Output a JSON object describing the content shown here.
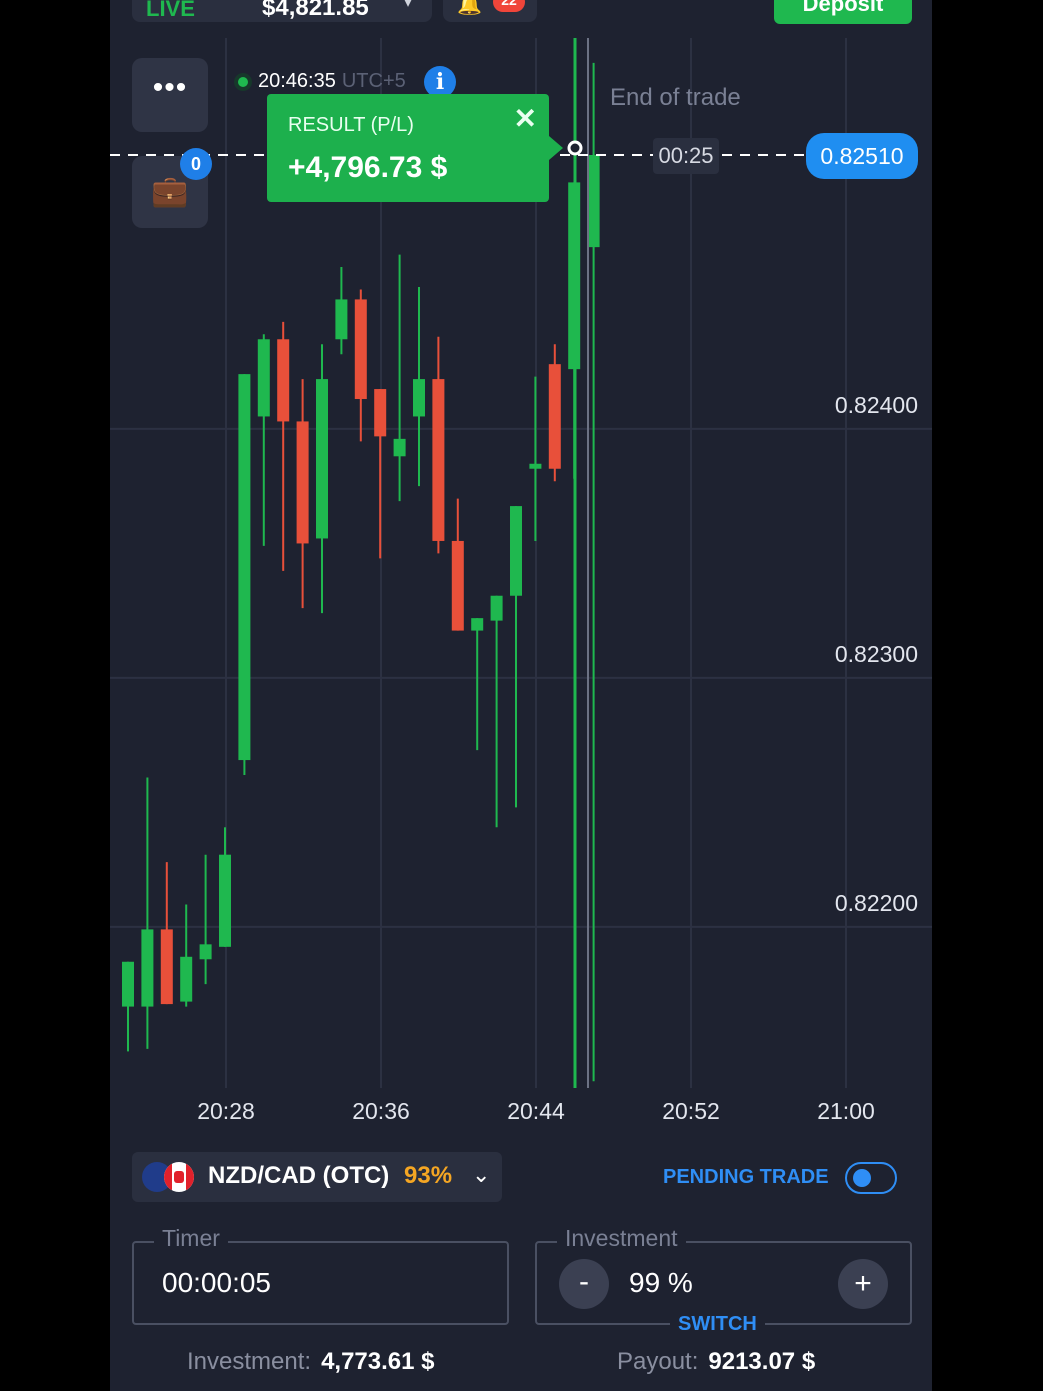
{
  "topbar": {
    "account_label": "LIVE",
    "balance": "$4,821.85",
    "notifications": "22",
    "deposit_label": "Deposit"
  },
  "chart_header": {
    "time": "20:46:35",
    "timezone": "UTC+5",
    "end_of_trade": "End of trade",
    "countdown": "00:25",
    "current_price": "0.82510",
    "open_trades": "0"
  },
  "result_popup": {
    "title": "RESULT (P/L)",
    "amount": "+4,796.73 $"
  },
  "axes": {
    "y_ticks": [
      "0.82400",
      "0.82300",
      "0.82200"
    ],
    "x_ticks": [
      "20:28",
      "20:36",
      "20:44",
      "20:52",
      "21:00"
    ]
  },
  "chart_data": {
    "type": "candlestick",
    "ylim": [
      0.82138,
      0.82556
    ],
    "x_ticks": [
      "20:28",
      "20:36",
      "20:44",
      "20:52",
      "21:00"
    ],
    "current_price": 0.8251,
    "candles": [
      {
        "o": 0.82168,
        "h": 0.8218,
        "l": 0.8215,
        "c": 0.82186,
        "dir": "up"
      },
      {
        "o": 0.82168,
        "h": 0.8226,
        "l": 0.82151,
        "c": 0.82199,
        "dir": "up"
      },
      {
        "o": 0.82199,
        "h": 0.82226,
        "l": 0.82174,
        "c": 0.82169,
        "dir": "down"
      },
      {
        "o": 0.8217,
        "h": 0.82209,
        "l": 0.82168,
        "c": 0.82188,
        "dir": "up"
      },
      {
        "o": 0.82187,
        "h": 0.82229,
        "l": 0.82177,
        "c": 0.82193,
        "dir": "up"
      },
      {
        "o": 0.82192,
        "h": 0.8224,
        "l": 0.82192,
        "c": 0.82229,
        "dir": "up"
      },
      {
        "o": 0.82267,
        "h": 0.82412,
        "l": 0.82261,
        "c": 0.82422,
        "dir": "up"
      },
      {
        "o": 0.82405,
        "h": 0.82438,
        "l": 0.82353,
        "c": 0.82436,
        "dir": "up"
      },
      {
        "o": 0.82436,
        "h": 0.82443,
        "l": 0.82343,
        "c": 0.82403,
        "dir": "down"
      },
      {
        "o": 0.82403,
        "h": 0.8242,
        "l": 0.82328,
        "c": 0.82354,
        "dir": "down"
      },
      {
        "o": 0.82356,
        "h": 0.82434,
        "l": 0.82326,
        "c": 0.8242,
        "dir": "up"
      },
      {
        "o": 0.82436,
        "h": 0.82465,
        "l": 0.8243,
        "c": 0.82452,
        "dir": "up"
      },
      {
        "o": 0.82452,
        "h": 0.82456,
        "l": 0.82395,
        "c": 0.82412,
        "dir": "down"
      },
      {
        "o": 0.82416,
        "h": 0.82388,
        "l": 0.82348,
        "c": 0.82397,
        "dir": "down"
      },
      {
        "o": 0.82396,
        "h": 0.8247,
        "l": 0.82371,
        "c": 0.82389,
        "dir": "up"
      },
      {
        "o": 0.82405,
        "h": 0.82457,
        "l": 0.82377,
        "c": 0.8242,
        "dir": "up"
      },
      {
        "o": 0.8242,
        "h": 0.82437,
        "l": 0.8235,
        "c": 0.82355,
        "dir": "down"
      },
      {
        "o": 0.82355,
        "h": 0.82372,
        "l": 0.82319,
        "c": 0.82319,
        "dir": "down"
      },
      {
        "o": 0.82319,
        "h": 0.82323,
        "l": 0.82271,
        "c": 0.82324,
        "dir": "up"
      },
      {
        "o": 0.82323,
        "h": 0.82316,
        "l": 0.8224,
        "c": 0.82333,
        "dir": "up"
      },
      {
        "o": 0.82333,
        "h": 0.82369,
        "l": 0.82248,
        "c": 0.82369,
        "dir": "up"
      },
      {
        "o": 0.82386,
        "h": 0.82421,
        "l": 0.82355,
        "c": 0.82384,
        "dir": "up"
      },
      {
        "o": 0.82426,
        "h": 0.82434,
        "l": 0.82379,
        "c": 0.82384,
        "dir": "down"
      },
      {
        "o": 0.82424,
        "h": 0.82485,
        "l": 0.8238,
        "c": 0.82499,
        "dir": "up"
      },
      {
        "o": 0.82473,
        "h": 0.82547,
        "l": 0.82138,
        "c": 0.8251,
        "dir": "up"
      }
    ]
  },
  "asset": {
    "name": "NZD/CAD (OTC)",
    "payout_pct": "93%"
  },
  "pending_trade_label": "PENDING TRADE",
  "timer": {
    "legend": "Timer",
    "value": "00:00:05"
  },
  "investment": {
    "legend": "Investment",
    "value": "99 %",
    "minus": "-",
    "plus": "+",
    "switch_label": "SWITCH"
  },
  "footer": {
    "investment_label": "Investment:",
    "investment_value": "4,773.61 $",
    "payout_label": "Payout:",
    "payout_value": "9213.07 $"
  },
  "colors": {
    "bg": "#1e2230",
    "up": "#1fb84f",
    "down": "#e8503a",
    "accent": "#1f8ef1"
  }
}
